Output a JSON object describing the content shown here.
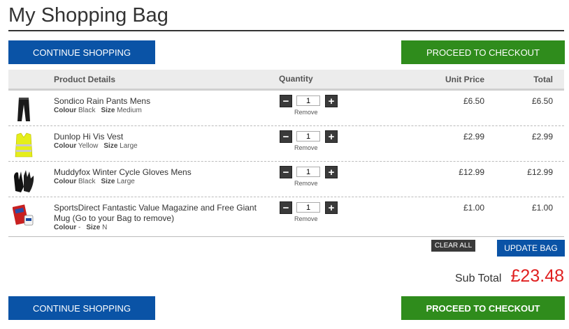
{
  "page": {
    "title": "My Shopping Bag"
  },
  "buttons": {
    "continue_top": "CONTINUE SHOPPING",
    "checkout_top": "PROCEED TO CHECKOUT",
    "continue_bottom": "CONTINUE SHOPPING",
    "checkout_bottom": "PROCEED TO CHECKOUT",
    "clear_all": "CLEAR ALL",
    "update_bag": "UPDATE BAG"
  },
  "table": {
    "headers": {
      "details": "Product Details",
      "quantity": "Quantity",
      "unit_price": "Unit Price",
      "total": "Total"
    },
    "colour_label": "Colour",
    "size_label": "Size",
    "remove_label": "Remove",
    "rows": [
      {
        "name": "Sondico Rain Pants Mens",
        "colour": "Black",
        "size": "Medium",
        "quantity": "1",
        "unit_price": "£6.50",
        "total": "£6.50",
        "icon": "rain-pants-icon"
      },
      {
        "name": "Dunlop Hi Vis Vest",
        "colour": "Yellow",
        "size": "Large",
        "quantity": "1",
        "unit_price": "£2.99",
        "total": "£2.99",
        "icon": "hi-vis-vest-icon"
      },
      {
        "name": "Muddyfox Winter Cycle Gloves Mens",
        "colour": "Black",
        "size": "Large",
        "quantity": "1",
        "unit_price": "£12.99",
        "total": "£12.99",
        "icon": "gloves-icon"
      },
      {
        "name": "SportsDirect Fantastic Value Magazine and Free Giant Mug (Go to your Bag to remove)",
        "colour": "-",
        "size": "N",
        "quantity": "1",
        "unit_price": "£1.00",
        "total": "£1.00",
        "icon": "magazine-icon"
      }
    ]
  },
  "summary": {
    "subtotal_label": "Sub Total",
    "subtotal_value": "£23.48"
  },
  "colors": {
    "primary_blue": "#0a53a6",
    "checkout_green": "#2f8c1c",
    "subtotal_red": "#e02020"
  }
}
